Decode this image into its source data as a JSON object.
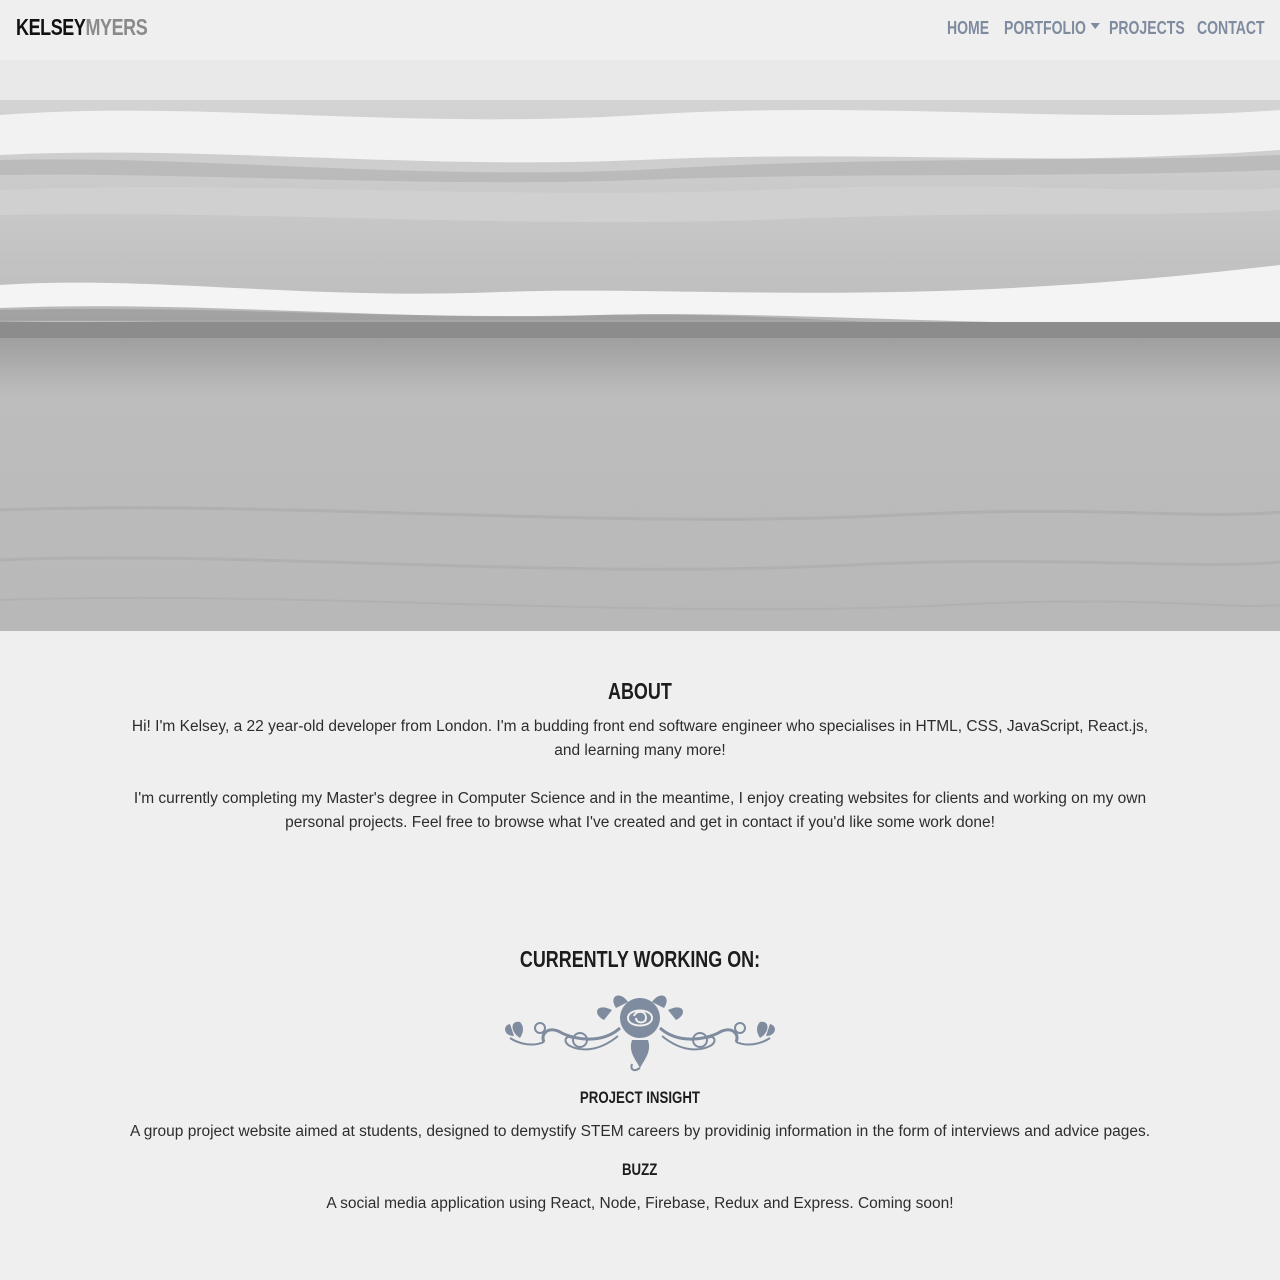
{
  "brand": {
    "first": "KELSEY",
    "last": "MYERS"
  },
  "nav": {
    "items": [
      {
        "label": "HOME",
        "dropdown": false
      },
      {
        "label": "PORTFOLIO",
        "dropdown": true
      },
      {
        "label": "PROJECTS",
        "dropdown": false
      },
      {
        "label": "CONTACT",
        "dropdown": false
      }
    ]
  },
  "hero": {
    "image": "beach-waves-photo"
  },
  "about": {
    "title": "ABOUT",
    "p1": "Hi! I'm Kelsey, a 22 year-old developer from London. I'm a budding front end software engineer who specialises in HTML, CSS, JavaScript, React.js, and learning many more!",
    "p2": "I'm currently completing my Master's degree in Computer Science and in the meantime, I enjoy creating websites for clients and working on my own personal projects. Feel free to browse what I've created and get in contact if you'd like some work done!"
  },
  "working": {
    "title": "CURRENTLY WORKING ON:",
    "ornament_icon": "rose-flourish-icon",
    "projects": [
      {
        "title": "PROJECT INSIGHT",
        "description": "A group project website aimed at students, designed to demystify STEM careers by providinig information in the form of interviews and advice pages."
      },
      {
        "title": "BUZZ",
        "description": "A social media application using React, Node, Firebase, Redux and Express. Coming soon!"
      }
    ]
  },
  "colors": {
    "background": "#efefef",
    "nav_link": "#7f8b9e",
    "ornament": "#7f8b9e",
    "heading": "#1d1d1d"
  }
}
